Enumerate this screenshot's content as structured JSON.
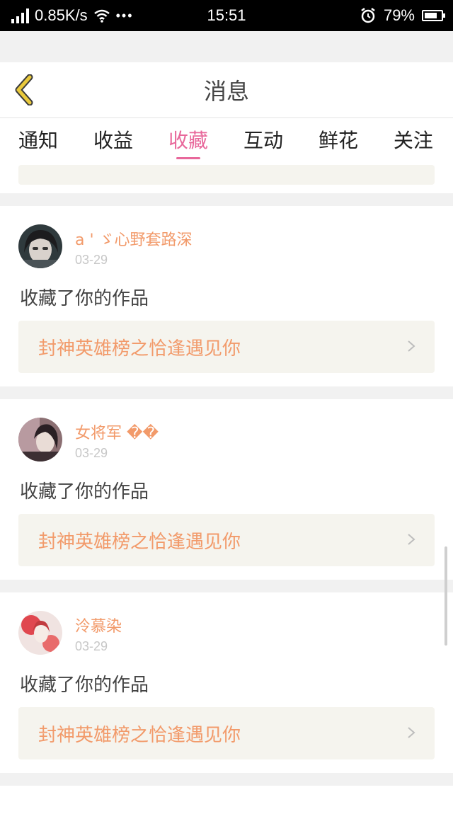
{
  "status_bar": {
    "network_speed": "0.85K/s",
    "dots": "•••",
    "time": "15:51",
    "battery_percent": "79%",
    "battery_level": 0.79
  },
  "header": {
    "title": "消息"
  },
  "tabs": [
    {
      "label": "通知",
      "active": false
    },
    {
      "label": "收益",
      "active": false
    },
    {
      "label": "收藏",
      "active": true
    },
    {
      "label": "互动",
      "active": false
    },
    {
      "label": "鲜花",
      "active": false
    },
    {
      "label": "关注",
      "active": false
    }
  ],
  "messages": [
    {
      "username": "a ' ゞ心野套路深",
      "date": "03-29",
      "action": "收藏了你的作品",
      "work_title": "封神英雄榜之恰逢遇见你"
    },
    {
      "username": "女将军 ��",
      "date": "03-29",
      "action": "收藏了你的作品",
      "work_title": "封神英雄榜之恰逢遇见你"
    },
    {
      "username": "泠慕染",
      "date": "03-29",
      "action": "收藏了你的作品",
      "work_title": "封神英雄榜之恰逢遇见你"
    }
  ],
  "colors": {
    "accent_pink": "#e8689b",
    "name_orange": "#f29a6a",
    "back_arrow": "#e9c93c"
  },
  "icons": {
    "back": "chevron-left-icon",
    "item_arrow": "chevron-right-icon"
  }
}
